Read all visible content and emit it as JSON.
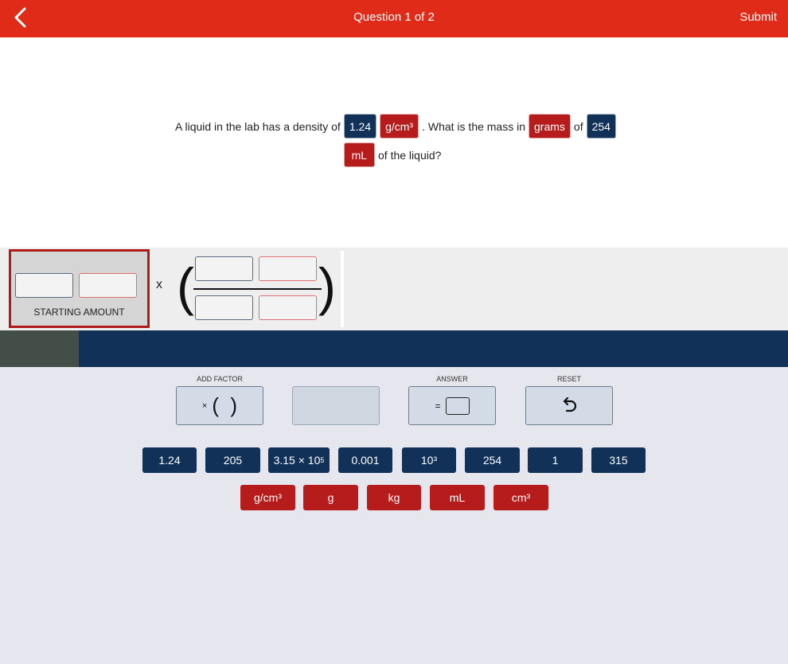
{
  "header": {
    "title": "Question 1 of 2",
    "submit_label": "Submit"
  },
  "question": {
    "part1": "A liquid in the lab has a density of",
    "density_value": "1.24",
    "density_unit": "g/cm³",
    "part2": ". What is the mass in",
    "target_unit": "grams",
    "part3": "of",
    "volume_value": "254",
    "volume_unit": "mL",
    "part4": "of the liquid?"
  },
  "workspace": {
    "starting_amount_label": "STARTING AMOUNT",
    "times_symbol": "x"
  },
  "tools": {
    "add_factor_label": "ADD FACTOR",
    "answer_label": "ANSWER",
    "reset_label": "RESET",
    "factor_x": "×",
    "answer_eq": "="
  },
  "number_tiles": [
    {
      "label": "1.24"
    },
    {
      "label": "205"
    },
    {
      "base": "3.15 × 10",
      "exp": "5"
    },
    {
      "label": "0.001"
    },
    {
      "label": "10³"
    },
    {
      "label": "254"
    },
    {
      "label": "1"
    },
    {
      "label": "315"
    }
  ],
  "unit_tiles": [
    {
      "label": "g/cm³"
    },
    {
      "label": "g"
    },
    {
      "label": "kg"
    },
    {
      "label": "mL"
    },
    {
      "label": "cm³"
    }
  ],
  "icons": {
    "back": "chevron-left-icon",
    "reset": "undo-icon"
  },
  "colors": {
    "header_red": "#e02b18",
    "navy": "#113159",
    "unit_red": "#b71c1c"
  }
}
